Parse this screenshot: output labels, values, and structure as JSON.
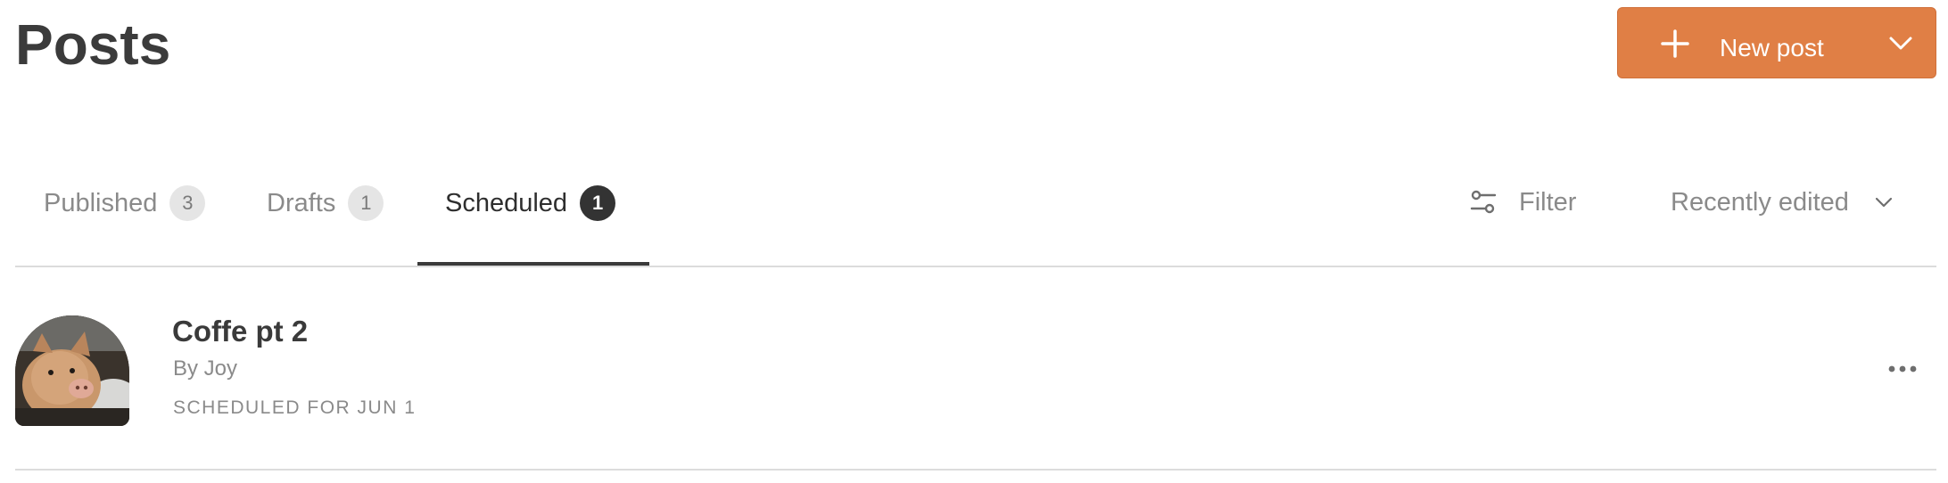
{
  "header": {
    "title": "Posts",
    "new_post_label": "New post"
  },
  "tabs": [
    {
      "label": "Published",
      "count": "3"
    },
    {
      "label": "Drafts",
      "count": "1"
    },
    {
      "label": "Scheduled",
      "count": "1"
    }
  ],
  "active_tab": "Scheduled",
  "toolbar": {
    "filter_label": "Filter",
    "sort_label": "Recently edited"
  },
  "posts": [
    {
      "title": "Coffe pt 2",
      "author": "By Joy",
      "status": "SCHEDULED FOR JUN 1"
    }
  ],
  "colors": {
    "accent": "#e07f45",
    "active_badge": "#333333",
    "inactive_badge": "#e5e5e5",
    "text_muted": "#8a8a8a",
    "divider": "#dcdcdc"
  },
  "icons": {
    "new_post": "plus-icon",
    "new_post_menu": "chevron-down-icon",
    "filter": "sliders-icon",
    "sort": "chevron-down-icon",
    "post_menu": "more-horizontal-icon"
  }
}
